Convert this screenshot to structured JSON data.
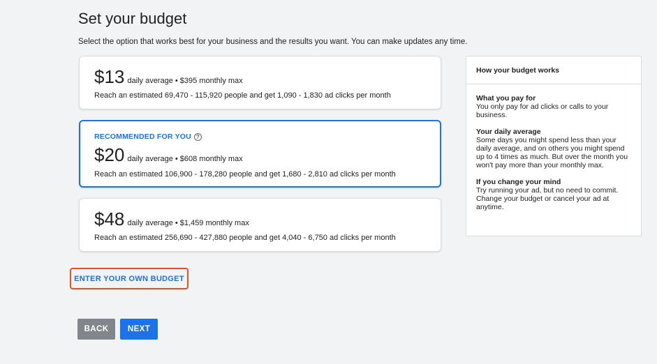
{
  "page": {
    "title": "Set your budget",
    "subtitle": "Select the option that works best for your business and the results you want. You can make updates any time."
  },
  "options": [
    {
      "price": "$13",
      "detail": "daily average • $395 monthly max",
      "reach": "Reach an estimated 69,470 - 115,920 people and get 1,090 - 1,830 ad clicks per month",
      "recommended": ""
    },
    {
      "price": "$20",
      "detail": "daily average • $608 monthly max",
      "reach": "Reach an estimated 106,900 - 178,280 people and get 1,680 - 2,810 ad clicks per month",
      "recommended": "RECOMMENDED FOR YOU",
      "help_icon": "?"
    },
    {
      "price": "$48",
      "detail": "daily average • $1,459 monthly max",
      "reach": "Reach an estimated 256,690 - 427,880 people and get 4,040 - 6,750 ad clicks per month",
      "recommended": ""
    }
  ],
  "own_budget_label": "ENTER YOUR OWN BUDGET",
  "buttons": {
    "back": "BACK",
    "next": "NEXT"
  },
  "info": {
    "header": "How your budget works",
    "sections": [
      {
        "title": "What you pay for",
        "text": "You only pay for ad clicks or calls to your business."
      },
      {
        "title": "Your daily average",
        "text": "Some days you might spend less than your daily average, and on others you might spend up to 4 times as much. But over the month you won't pay more than your monthly max."
      },
      {
        "title": "If you change your mind",
        "text": "Try running your ad, but no need to commit. Change your budget or cancel your ad at anytime."
      }
    ]
  },
  "colors": {
    "accent": "#1a73e8",
    "highlight_border": "#e8511f",
    "back_button": "#80868b",
    "page_background": "#f1f3f4"
  }
}
